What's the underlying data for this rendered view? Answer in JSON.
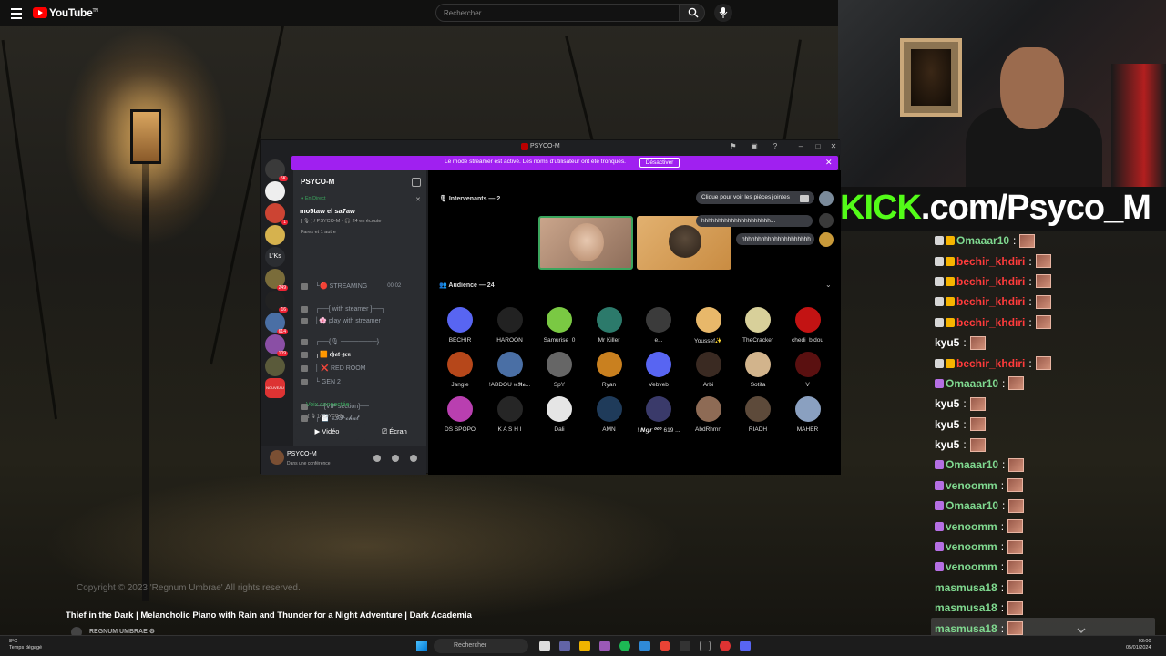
{
  "youtube": {
    "logo": "YouTube",
    "logo_suffix": "TN",
    "search_placeholder": "Rechercher",
    "copyright": "Copyright © 2023 'Regnum Umbrae' All rights reserved.",
    "video_title": "Thief in the Dark | Melancholic Piano with Rain and Thunder for a Night Adventure | Dark Academia",
    "channel": "REGNUM UMBRAE ⚙"
  },
  "kick_banner": {
    "prefix": "KICK",
    "suffix": ".com/Psyco_M"
  },
  "chat": {
    "messages": [
      {
        "user": "Omaaar10",
        "color": "#7fd88f",
        "badges": [
          "sub",
          "crown"
        ],
        "highlight": false
      },
      {
        "user": "bechir_khdiri",
        "color": "#ff3b3b",
        "badges": [
          "sub",
          "crown"
        ],
        "highlight": false
      },
      {
        "user": "bechir_khdiri",
        "color": "#ff3b3b",
        "badges": [
          "sub",
          "crown"
        ],
        "highlight": false
      },
      {
        "user": "bechir_khdiri",
        "color": "#ff3b3b",
        "badges": [
          "sub",
          "crown"
        ],
        "highlight": false
      },
      {
        "user": "bechir_khdiri",
        "color": "#ff3b3b",
        "badges": [
          "sub",
          "crown"
        ],
        "highlight": false
      },
      {
        "user": "kyu5",
        "color": "#ffffff",
        "badges": [],
        "highlight": false
      },
      {
        "user": "bechir_khdiri",
        "color": "#ff3b3b",
        "badges": [
          "sub",
          "crown"
        ],
        "highlight": false
      },
      {
        "user": "Omaaar10",
        "color": "#7fd88f",
        "badges": [
          "mod"
        ],
        "highlight": false
      },
      {
        "user": "kyu5",
        "color": "#ffffff",
        "badges": [],
        "highlight": false
      },
      {
        "user": "kyu5",
        "color": "#ffffff",
        "badges": [],
        "highlight": false
      },
      {
        "user": "kyu5",
        "color": "#ffffff",
        "badges": [],
        "highlight": false
      },
      {
        "user": "Omaaar10",
        "color": "#7fd88f",
        "badges": [
          "mod"
        ],
        "highlight": false
      },
      {
        "user": "venoomm",
        "color": "#7fd88f",
        "badges": [
          "mod"
        ],
        "highlight": false
      },
      {
        "user": "Omaaar10",
        "color": "#7fd88f",
        "badges": [
          "mod"
        ],
        "highlight": false
      },
      {
        "user": "venoomm",
        "color": "#7fd88f",
        "badges": [
          "mod"
        ],
        "highlight": false
      },
      {
        "user": "venoomm",
        "color": "#7fd88f",
        "badges": [
          "mod"
        ],
        "highlight": false
      },
      {
        "user": "venoomm",
        "color": "#7fd88f",
        "badges": [
          "mod"
        ],
        "highlight": false
      },
      {
        "user": "masmusa18",
        "color": "#7fd88f",
        "badges": [],
        "highlight": false
      },
      {
        "user": "masmusa18",
        "color": "#7fd88f",
        "badges": [],
        "highlight": false
      },
      {
        "user": "masmusa18",
        "color": "#7fd88f",
        "badges": [],
        "highlight": true
      },
      {
        "user": "masmusa18",
        "color": "#7fd88f",
        "badges": [],
        "highlight": true
      }
    ],
    "separator": ":"
  },
  "discord": {
    "window_title": "PSYCO-M",
    "streamer_notice": "Le mode streamer est activé. Les noms d'utilisateur ont été tronqués.",
    "streamer_button": "Désactiver",
    "server_name": "PSYCO-M",
    "event": {
      "live": "● En Direct",
      "title": "mo5taw el sa7aw",
      "meta": "[ 🎙 ] / PSYCO-M · 🎧 24 en écoute",
      "people": "Fares et 1 autre"
    },
    "channels": [
      {
        "label": "└🔴 STREAMING",
        "extra": "00  02",
        "active": false
      },
      {
        "label": "┌──[ with steamer ]──┐",
        "extra": "",
        "active": false
      },
      {
        "label": "│🌸 play with streamer",
        "extra": "",
        "active": false
      },
      {
        "label": "┌──{🎙 ────────}",
        "extra": "",
        "active": false
      },
      {
        "label": "┌🟧 𝖈𝖍𝖆𝖙-𝖌𝖊𝖓",
        "extra": "",
        "active": true
      },
      {
        "label": "│ ❌ RED ROOM",
        "extra": "",
        "active": false
      },
      {
        "label": "└ GEN 2",
        "extra": "",
        "active": false
      },
      {
        "label": "──[VIP section]──",
        "extra": "",
        "active": false
      },
      {
        "label": "┌ 📄 𝓿𝓘𝓟-𝓬𝓱𝓪𝓽",
        "extra": "",
        "active": false
      }
    ],
    "voice_connected": "Voix connectée",
    "voice_sub": "[ 🎙 ] / PSYCO-M",
    "video_button": "Vidéo",
    "screen_button": "Écran",
    "user": {
      "name": "PSYCO-M",
      "status": "Dans une conférence"
    },
    "speakers_label": "Intervenants — 2",
    "audience_label": "Audience — 24",
    "attach_hint": "Clique pour voir les pièces jointes",
    "bubble1": "hhhhhhhhhhhhhhhhhhhhh...",
    "bubble2": "hhhhhhhhhhhhhhhhhhhhh",
    "audience": [
      {
        "name": "BECHIR",
        "color": "#5865f2"
      },
      {
        "name": "HAROON",
        "color": "#222222"
      },
      {
        "name": "Samurise_0",
        "color": "#7ac943"
      },
      {
        "name": "Mr Killer",
        "color": "#2c7a6b"
      },
      {
        "name": "e...",
        "color": "#3b3b3b"
      },
      {
        "name": "Youssef✨",
        "color": "#e8b86a"
      },
      {
        "name": "TheCracker",
        "color": "#d8d09a"
      },
      {
        "name": "chedi_bidou",
        "color": "#c31313"
      },
      {
        "name": "Jangle",
        "color": "#b6471a"
      },
      {
        "name": "!ABDOU 𝖒𝕽𝖆...",
        "color": "#4a6fa5"
      },
      {
        "name": "SpY",
        "color": "#666666"
      },
      {
        "name": "Ryan",
        "color": "#c9801f"
      },
      {
        "name": "Vebveb",
        "color": "#5865f2"
      },
      {
        "name": "Arbi",
        "color": "#3a2a22"
      },
      {
        "name": "Sotifa",
        "color": "#d2b48c"
      },
      {
        "name": "V",
        "color": "#5a1010"
      },
      {
        "name": "DS SPOPO",
        "color": "#b93fb0"
      },
      {
        "name": "K A S H I",
        "color": "#262626"
      },
      {
        "name": "Dali",
        "color": "#e5e5e5"
      },
      {
        "name": "AMN",
        "color": "#1f3b5a"
      },
      {
        "name": "! 𝙉𝙜𝙧 ⁰⁰⁰ 619 ...",
        "color": "#3a3a6a"
      },
      {
        "name": "AbdRhmn",
        "color": "#8e6b55"
      },
      {
        "name": "RIADH",
        "color": "#5d4a3a"
      },
      {
        "name": "MAHER",
        "color": "#8aa0c0"
      }
    ]
  },
  "taskbar": {
    "temp": "8°C",
    "weather": "Temps dégagé",
    "search": "Rechercher",
    "time": "03:00",
    "date": "05/01/2024"
  }
}
